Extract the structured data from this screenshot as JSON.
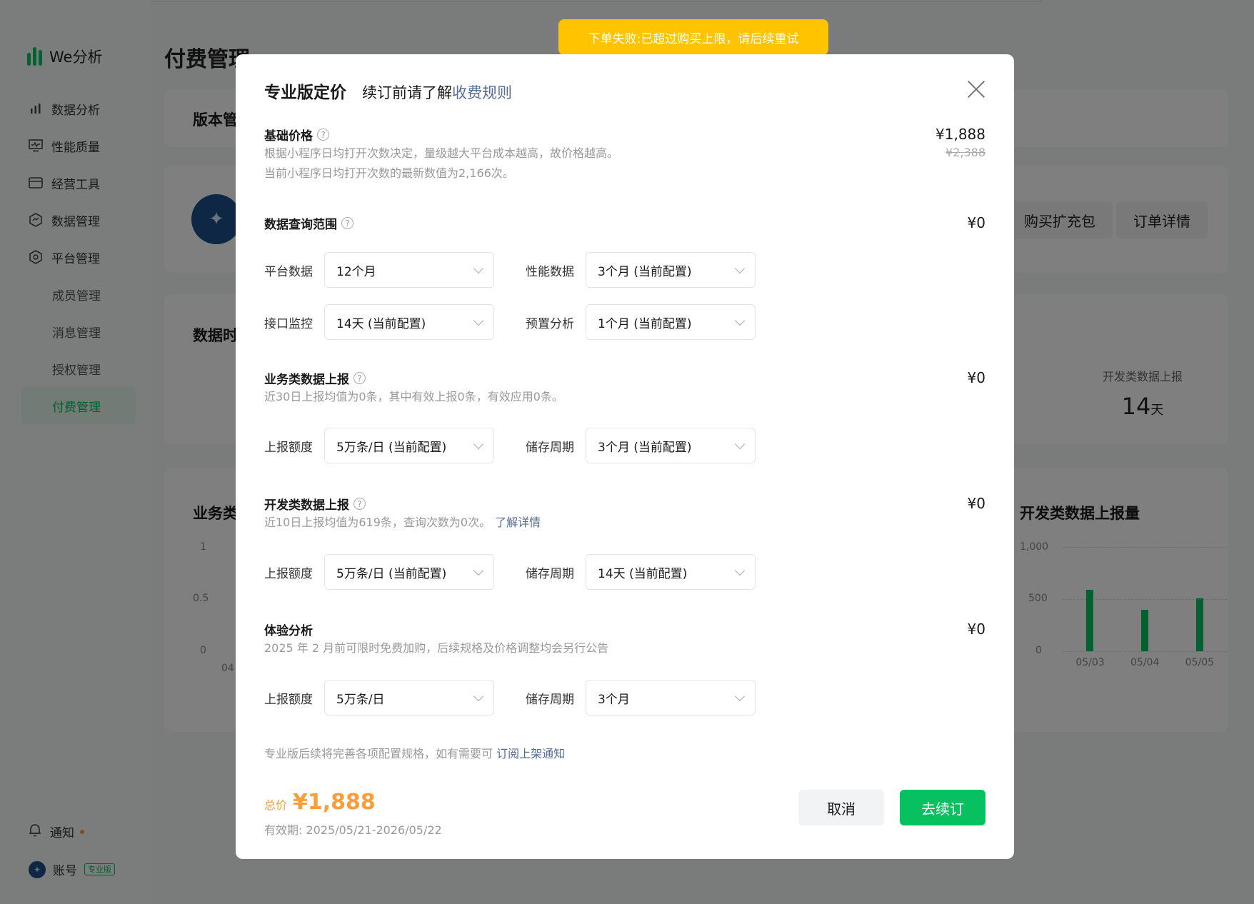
{
  "sidebar": {
    "brand": "We分析",
    "nav": [
      {
        "label": "数据分析",
        "icon": "bar-chart-icon"
      },
      {
        "label": "性能质量",
        "icon": "monitor-icon"
      },
      {
        "label": "经营工具",
        "icon": "card-icon"
      },
      {
        "label": "数据管理",
        "icon": "database-icon"
      },
      {
        "label": "平台管理",
        "icon": "settings-icon"
      }
    ],
    "sub": [
      "成员管理",
      "消息管理",
      "授权管理",
      "付费管理"
    ],
    "notice": "通知",
    "account": "账号",
    "account_badge": "专业版"
  },
  "background": {
    "page_title": "付费管理",
    "version_title": "版本管",
    "buttons": [
      "购买扩充包",
      "订单详情"
    ],
    "data_title": "数据时",
    "dev_report_label": "开发类数据上报",
    "dev_report_value": "14",
    "dev_report_unit": "天",
    "biz_chart_title": "业务类",
    "dev_chart_title": "开发类数据上报量",
    "left_axis": [
      "1",
      "0.5",
      "0"
    ],
    "left_x_partial": "04",
    "right_axis": [
      "1,000",
      "500",
      "0"
    ]
  },
  "chart_data": {
    "type": "bar",
    "title": "开发类数据上报量",
    "categories": [
      "05/03",
      "05/04",
      "05/05"
    ],
    "values": [
      590,
      400,
      510
    ],
    "ylim": [
      0,
      1000
    ]
  },
  "toast": "下单失败:已超过购买上限，请后续重试",
  "modal": {
    "title": "专业版定价",
    "subtitle": "续订前请了解",
    "rules_link": "收费规则",
    "help_glyph": "?",
    "base": {
      "title": "基础价格",
      "desc1": "根据小程序日均打开次数决定，量级越大平台成本越高，故价格越高。",
      "desc2": "当前小程序日均打开次数的最新数值为2,166次。",
      "price": "¥1,888",
      "old_price": "¥2,388"
    },
    "query": {
      "title": "数据查询范围",
      "price": "¥0",
      "platform_label": "平台数据",
      "platform_value": "12个月",
      "perf_label": "性能数据",
      "perf_value": "3个月 (当前配置)",
      "api_label": "接口监控",
      "api_value": "14天 (当前配置)",
      "preset_label": "预置分析",
      "preset_value": "1个月 (当前配置)"
    },
    "biz": {
      "title": "业务类数据上报",
      "desc": "近30日上报均值为0条，其中有效上报0条，有效应用0条。",
      "price": "¥0",
      "quota_label": "上报额度",
      "quota_value": "5万条/日 (当前配置)",
      "period_label": "储存周期",
      "period_value": "3个月 (当前配置)"
    },
    "dev": {
      "title": "开发类数据上报",
      "desc": "近10日上报均值为619条，查询次数为0次。",
      "link": "了解详情",
      "price": "¥0",
      "quota_label": "上报额度",
      "quota_value": "5万条/日 (当前配置)",
      "period_label": "储存周期",
      "period_value": "14天 (当前配置)"
    },
    "exp": {
      "title": "体验分析",
      "desc": "2025 年 2 月前可限时免费加购，后续规格及价格调整均会另行公告",
      "price": "¥0",
      "quota_label": "上报额度",
      "quota_value": "5万条/日",
      "period_label": "储存周期",
      "period_value": "3个月"
    },
    "note": "专业版后续将完善各项配置规格，如有需要可",
    "note_link": "订阅上架通知",
    "total_label": "总价",
    "total_value": "¥1,888",
    "validity": "有效期: 2025/05/21-2026/05/22",
    "cancel": "取消",
    "confirm": "去续订"
  }
}
